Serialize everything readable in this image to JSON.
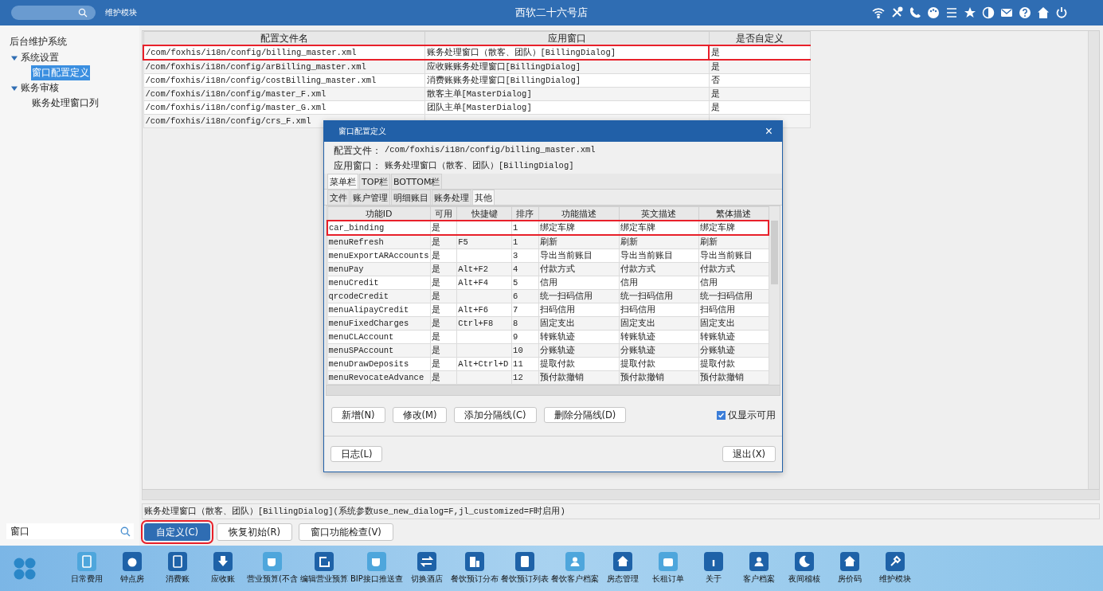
{
  "top_bar": {
    "module_label": "维护模块",
    "title": "西软二十六号店"
  },
  "sidebar": {
    "title": "后台维护系统",
    "items": [
      {
        "label": "系统设置",
        "expanded": true,
        "children": [
          {
            "label": "窗口配置定义",
            "selected": true
          }
        ]
      },
      {
        "label": "账务审核",
        "expanded": true,
        "children": [
          {
            "label": "账务处理窗口列",
            "selected": false
          }
        ]
      }
    ],
    "search": {
      "value": "窗口"
    }
  },
  "config_table": {
    "columns": [
      "配置文件名",
      "应用窗口",
      "是否自定义"
    ],
    "rows": [
      {
        "cells": [
          "/com/foxhis/i18n/config/billing_master.xml",
          "账务处理窗口（散客、团队）[BillingDialog]",
          "是"
        ],
        "highlighted": true
      },
      {
        "cells": [
          "/com/foxhis/i18n/config/arBilling_master.xml",
          "应收账账务处理窗口[BillingDialog]",
          "是"
        ],
        "highlighted": false
      },
      {
        "cells": [
          "/com/foxhis/i18n/config/costBilling_master.xml",
          "消费账账务处理窗口[BillingDialog]",
          "否"
        ],
        "highlighted": false
      },
      {
        "cells": [
          "/com/foxhis/i18n/config/master_F.xml",
          "散客主单[MasterDialog]",
          "是"
        ],
        "highlighted": false
      },
      {
        "cells": [
          "/com/foxhis/i18n/config/master_G.xml",
          "团队主单[MasterDialog]",
          "是"
        ],
        "highlighted": false
      },
      {
        "cells": [
          "/com/foxhis/i18n/config/crs_F.xml"
        ],
        "highlighted": false
      }
    ]
  },
  "status_text": "账务处理窗口（散客、团队）[BillingDialog](系统参数use_new_dialog=F,jl_customized=F时启用)",
  "actions": [
    {
      "label": "自定义(C)",
      "primary": true,
      "highlighted": true
    },
    {
      "label": "恢复初始(R)",
      "primary": false,
      "highlighted": false
    },
    {
      "label": "窗口功能检查(V)",
      "primary": false,
      "highlighted": false
    }
  ],
  "dialog": {
    "title": "窗口配置定义",
    "close": "×",
    "fields": [
      {
        "label": "配置文件：",
        "value": "/com/foxhis/i18n/config/billing_master.xml"
      },
      {
        "label": "应用窗口：",
        "value": "账务处理窗口（散客、团队）[BillingDialog]"
      }
    ],
    "tabs": [
      {
        "label": "菜单栏",
        "selected": true
      },
      {
        "label": "TOP栏",
        "selected": false
      },
      {
        "label": "BOTTOM栏",
        "selected": false
      }
    ],
    "subtabs": [
      {
        "label": "文件",
        "selected": false
      },
      {
        "label": "账户管理",
        "selected": false
      },
      {
        "label": "明细账目",
        "selected": false
      },
      {
        "label": "账务处理",
        "selected": false
      },
      {
        "label": "其他",
        "selected": true
      }
    ],
    "columns": [
      "功能ID",
      "可用",
      "快捷键",
      "排序",
      "功能描述",
      "英文描述",
      "繁体描述"
    ],
    "rows": [
      {
        "cells": [
          "car_binding",
          "是",
          "",
          "1",
          "绑定车牌",
          "绑定车牌",
          "绑定车牌"
        ],
        "highlighted": true
      },
      {
        "cells": [
          "menuRefresh",
          "是",
          "F5",
          "1",
          "刷新",
          "刷新",
          "刷新"
        ],
        "highlighted": false
      },
      {
        "cells": [
          "menuExportARAccounts",
          "是",
          "",
          "3",
          "导出当前账目",
          "导出当前账目",
          "导出当前账目"
        ],
        "highlighted": false
      },
      {
        "cells": [
          "menuPay",
          "是",
          "Alt+F2",
          "4",
          "付款方式",
          "付款方式",
          "付款方式"
        ],
        "highlighted": false
      },
      {
        "cells": [
          "menuCredit",
          "是",
          "Alt+F4",
          "5",
          "信用",
          "信用",
          "信用"
        ],
        "highlighted": false
      },
      {
        "cells": [
          "qrcodeCredit",
          "是",
          "",
          "6",
          "统一扫码信用",
          "统一扫码信用",
          "统一扫码信用"
        ],
        "highlighted": false
      },
      {
        "cells": [
          "menuAlipayCredit",
          "是",
          "Alt+F6",
          "7",
          "扫码信用",
          "扫码信用",
          "扫码信用"
        ],
        "highlighted": false
      },
      {
        "cells": [
          "menuFixedCharges",
          "是",
          "Ctrl+F8",
          "8",
          "固定支出",
          "固定支出",
          "固定支出"
        ],
        "highlighted": false
      },
      {
        "cells": [
          "menuCLAccount",
          "是",
          "",
          "9",
          "转账轨迹",
          "转账轨迹",
          "转账轨迹"
        ],
        "highlighted": false
      },
      {
        "cells": [
          "menuSPAccount",
          "是",
          "",
          "10",
          "分账轨迹",
          "分账轨迹",
          "分账轨迹"
        ],
        "highlighted": false
      },
      {
        "cells": [
          "menuDrawDeposits",
          "是",
          "Alt+Ctrl+D",
          "11",
          "提取付款",
          "提取付款",
          "提取付款"
        ],
        "highlighted": false
      },
      {
        "cells": [
          "menuRevocateAdvance",
          "是",
          "",
          "12",
          "预付款撤销",
          "预付款撤销",
          "预付款撤销"
        ],
        "highlighted": false
      }
    ],
    "buttons": [
      "新增(N)",
      "修改(M)",
      "添加分隔线(C)",
      "删除分隔线(D)"
    ],
    "checkbox": {
      "label": "仅显示可用",
      "checked": true
    },
    "footer_buttons": [
      "日志(L)",
      "退出(X)"
    ]
  },
  "taskbar": {
    "items": [
      {
        "label": "日常费用"
      },
      {
        "label": "钟点房"
      },
      {
        "label": "消费账"
      },
      {
        "label": "应收账"
      },
      {
        "label": "营业预算(不含"
      },
      {
        "label": "编辑营业预算"
      },
      {
        "label": "BIP接口推送查"
      },
      {
        "label": "切换酒店"
      },
      {
        "label": "餐饮预订分布"
      },
      {
        "label": "餐饮预订列表"
      },
      {
        "label": "餐饮客户档案"
      },
      {
        "label": "房态管理"
      },
      {
        "label": "长租订单"
      },
      {
        "label": "关于"
      },
      {
        "label": "客户档案"
      },
      {
        "label": "夜间稽核"
      },
      {
        "label": "房价码"
      },
      {
        "label": "维护模块"
      }
    ]
  }
}
